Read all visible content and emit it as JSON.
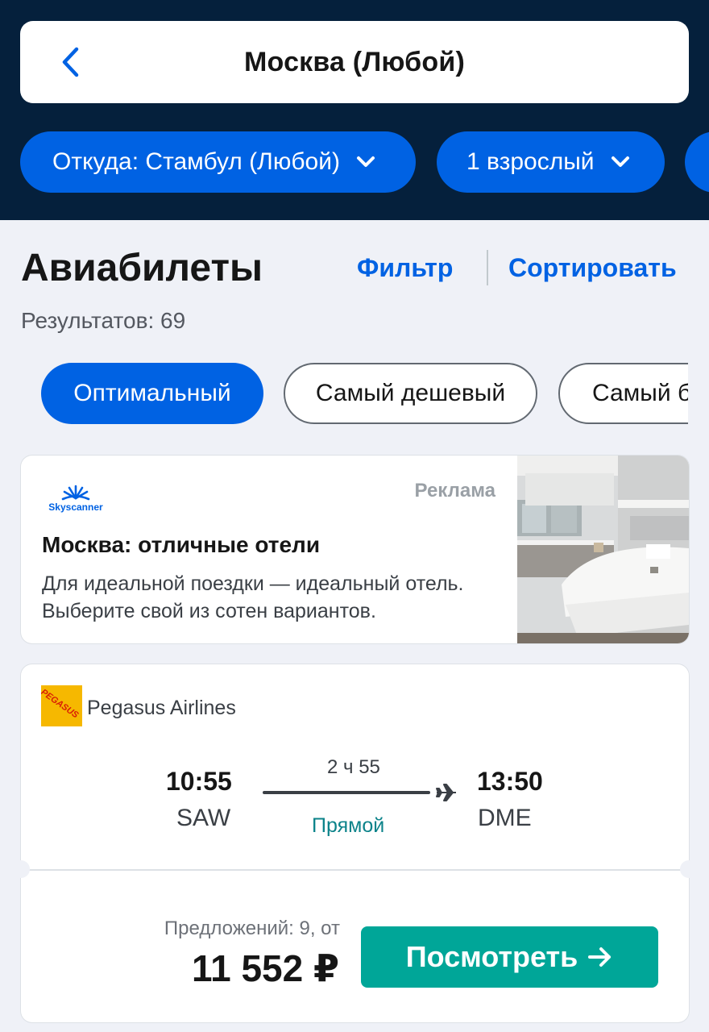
{
  "header": {
    "destination": "Москва (Любой)",
    "origin_pill": "Откуда: Стамбул (Любой)",
    "passengers_pill": "1 взрослый"
  },
  "results_section": {
    "title": "Авиабилеты",
    "filter_label": "Фильтр",
    "sort_label": "Сортировать",
    "results_count": "Результатов: 69"
  },
  "sort_tabs": [
    {
      "label": "Оптимальный",
      "active": true
    },
    {
      "label": "Самый дешевый",
      "active": false
    },
    {
      "label": "Самый б",
      "active": false
    }
  ],
  "ad": {
    "brand": "Skyscanner",
    "label": "Реклама",
    "title": "Москва: отличные отели",
    "text": "Для идеальной поездки — идеальный отель. Выберите свой из сотен вариантов."
  },
  "flight": {
    "airline": "Pegasus Airlines",
    "airline_logo_text": "PEGASUS",
    "departure_time": "10:55",
    "departure_airport": "SAW",
    "duration": "2 ч 55",
    "stops": "Прямой",
    "arrival_time": "13:50",
    "arrival_airport": "DME",
    "offers": "Предложений: 9, от",
    "price": "11 552 ₽",
    "view_button": "Посмотреть"
  },
  "colors": {
    "header_bg": "#05203c",
    "accent_blue": "#0062e3",
    "cta_teal": "#00a698",
    "direct_green": "#0c838a"
  }
}
